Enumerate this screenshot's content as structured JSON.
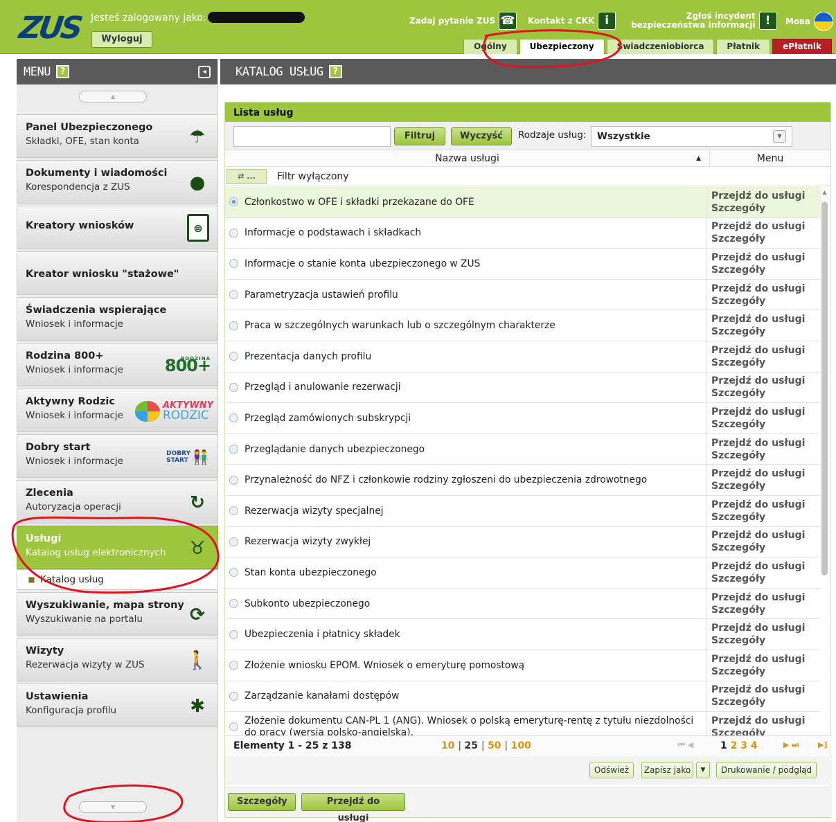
{
  "header": {
    "logo_text": "ZUS",
    "logged_in_label": "Jesteś zalogowany jako:",
    "logout_label": "Wyloguj",
    "ask_label": "Zadaj pytanie ZUS",
    "ckk_label": "Kontakt z CKK",
    "incident_line1": "Zgłoś incydent",
    "incident_line2": "bezpieczeństwa informacji",
    "language_label": "Мова",
    "tabs": [
      {
        "label": "Ogólny",
        "active": false
      },
      {
        "label": "Ubezpieczony",
        "active": true
      },
      {
        "label": "Świadczeniobiorca",
        "active": false
      },
      {
        "label": "Płatnik",
        "active": false
      },
      {
        "label": "ePłatnik",
        "active": false
      }
    ]
  },
  "sidebar": {
    "title": "MENU",
    "help": "?",
    "items": [
      {
        "title": "Panel Ubezpieczonego",
        "subtitle": "Składki, OFE, stan konta",
        "icon": "umbrella-icon"
      },
      {
        "title": "Dokumenty i wiadomości",
        "subtitle": "Korespondencja z ZUS",
        "icon": "speech-bubble-icon"
      },
      {
        "title": "Kreatory wniosków",
        "subtitle": "",
        "icon": "document-icon"
      },
      {
        "title": "Kreator wniosku \"stażowe\"",
        "subtitle": "",
        "icon": ""
      },
      {
        "title": "Świadczenia wspierające",
        "subtitle": "Wniosek i informacje",
        "icon": ""
      },
      {
        "title": "Rodzina 800+",
        "subtitle": "Wniosek i informacje",
        "icon": "rodzina-800-logo"
      },
      {
        "title": "Aktywny Rodzic",
        "subtitle": "Wniosek i informacje",
        "icon": "aktywny-rodzic-logo"
      },
      {
        "title": "Dobry start",
        "subtitle": "Wniosek i informacje",
        "icon": "dobry-start-logo"
      },
      {
        "title": "Zlecenia",
        "subtitle": "Autoryzacja operacji",
        "icon": "refresh-icon"
      },
      {
        "title": "Usługi",
        "subtitle": "Katalog usług elektronicznych",
        "icon": "services-icon"
      },
      {
        "title": "Wyszukiwanie, mapa strony",
        "subtitle": "Wyszukiwanie na portalu",
        "icon": "sync-icon"
      },
      {
        "title": "Wizyty",
        "subtitle": "Rezerwacja wizyty w ZUS",
        "icon": "walking-person-icon"
      },
      {
        "title": "Ustawienia",
        "subtitle": "Konfiguracja profilu",
        "icon": "puzzle-icon"
      }
    ],
    "sub_item": "Katalog usług",
    "logos": {
      "rodzina_small": "RODZINA",
      "rodzina_big": "800+",
      "aktywny": "AKTYWNY",
      "rodzic": "RODZIC",
      "dobry": "DOBRY",
      "start": "START"
    }
  },
  "main": {
    "title": "KATALOG USŁUG",
    "help": "?",
    "list_title": "Lista usług",
    "filter_button": "Filtruj",
    "clear_button": "Wyczyść",
    "types_label": "Rodzaje usług:",
    "types_value": "Wszystkie",
    "col_name": "Nazwa usługi",
    "col_menu": "Menu",
    "filter_toggle": "...",
    "filter_status": "Filtr wyłączony",
    "action_goto": "Przejdź do usługi",
    "action_details": "Szczegóły",
    "rows": [
      "Członkostwo w OFE i składki przekazane do OFE",
      "Informacje o podstawach i składkach",
      "Informacje o stanie konta ubezpieczonego w ZUS",
      "Parametryzacja ustawień profilu",
      "Praca w szczególnych warunkach lub o szczególnym charakterze",
      "Prezentacja danych profilu",
      "Przegląd i anulowanie rezerwacji",
      "Przegląd zamówionych subskrypcji",
      "Przeglądanie danych ubezpieczonego",
      "Przynależność do NFZ i członkowie rodziny zgłoszeni do ubezpieczenia zdrowotnego",
      "Rezerwacja wizyty specjalnej",
      "Rezerwacja wizyty zwykłej",
      "Stan konta ubezpieczonego",
      "Subkonto ubezpieczonego",
      "Ubezpieczenia i płatnicy składek",
      "Złożenie wniosku EPOM. Wniosek o emeryturę pomostową",
      "Zarządzanie kanałami dostępów",
      "Złożenie dokumentu CAN-PL 1 (ANG). Wniosek o polską emeryturę-rentę z tytułu niezdolności do pracy (wersja polsko-angielska)."
    ],
    "pager": {
      "count": "Elementy 1 - 25 z 138",
      "sizes": [
        "10",
        "25",
        "50",
        "100"
      ],
      "current_size": "25",
      "pages": [
        "1",
        "2",
        "3",
        "4"
      ],
      "current_page": "1"
    },
    "refresh": "Odśwież",
    "save_as": "Zapisz jako",
    "print": "Drukowanie / podgląd",
    "btn_details": "Szczegóły",
    "btn_goto": "Przejdź do usługi"
  }
}
